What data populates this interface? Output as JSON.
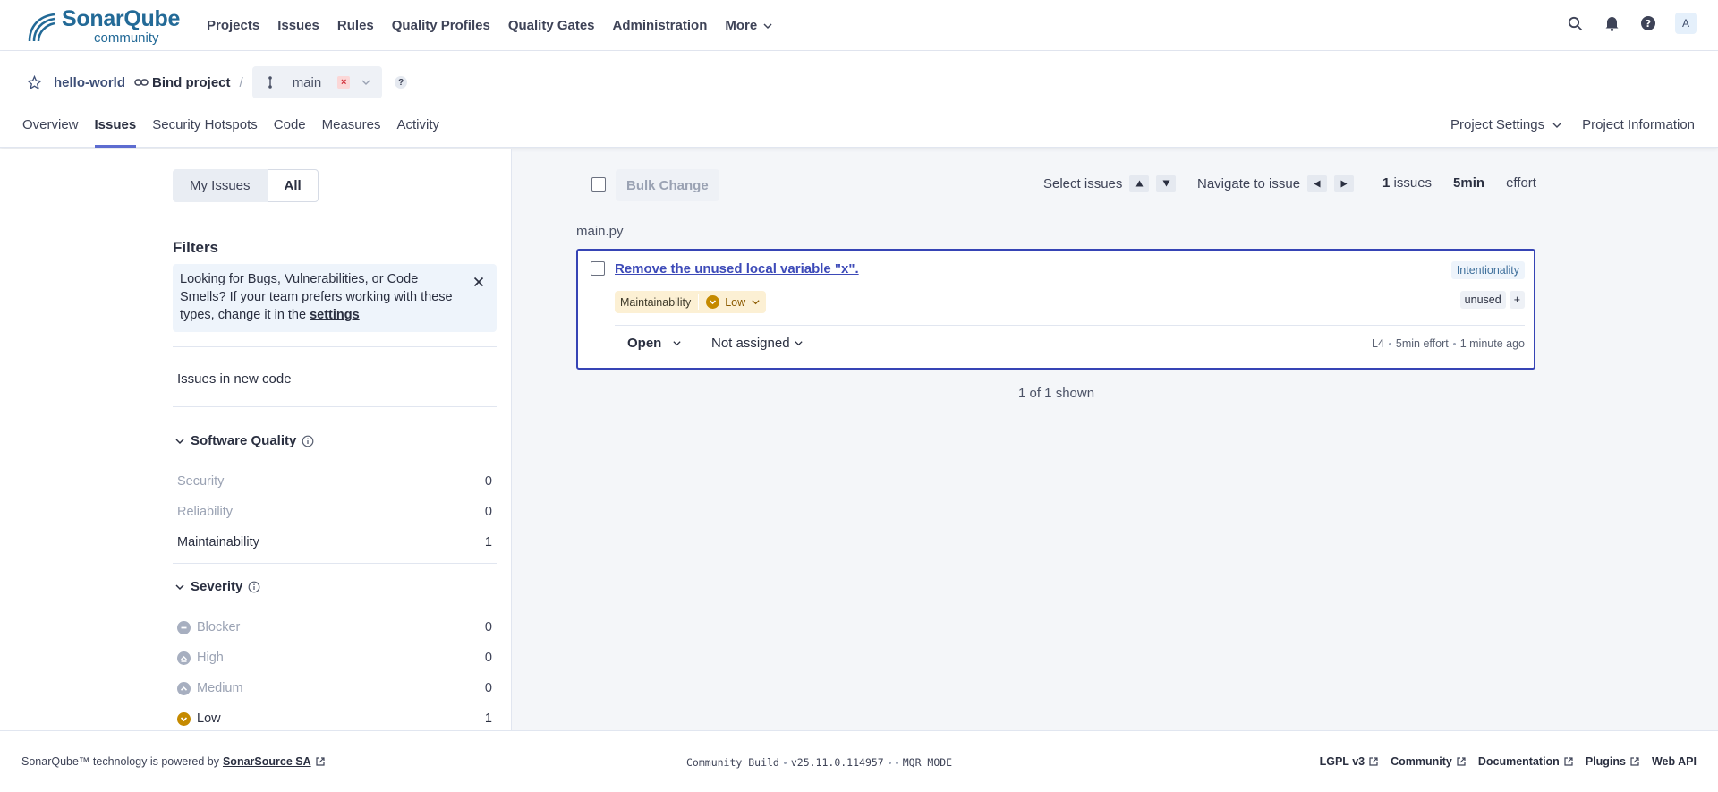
{
  "brand": {
    "title": "SonarQube",
    "subtitle": "community"
  },
  "nav": {
    "items": [
      "Projects",
      "Issues",
      "Rules",
      "Quality Profiles",
      "Quality Gates",
      "Administration"
    ],
    "more": "More",
    "avatar": "A"
  },
  "project": {
    "name": "hello-world",
    "bind": "Bind project",
    "separator": "/",
    "branch": "main",
    "branch_status": "×",
    "help": "?",
    "tabs": [
      "Overview",
      "Issues",
      "Security Hotspots",
      "Code",
      "Measures",
      "Activity"
    ],
    "active_tab": "Issues",
    "settings": "Project Settings",
    "information": "Project Information"
  },
  "sidebar": {
    "my_issues": "My Issues",
    "all": "All",
    "filters_title": "Filters",
    "banner_text": "Looking for Bugs, Vulnerabilities, or Code Smells? If your team prefers working with these types, change it in the ",
    "banner_link": "settings",
    "new_code": "Issues in new code",
    "software_quality": {
      "title": "Software Quality",
      "rows": [
        {
          "label": "Security",
          "count": "0"
        },
        {
          "label": "Reliability",
          "count": "0"
        },
        {
          "label": "Maintainability",
          "count": "1"
        }
      ]
    },
    "severity": {
      "title": "Severity",
      "rows": [
        {
          "label": "Blocker",
          "count": "0"
        },
        {
          "label": "High",
          "count": "0"
        },
        {
          "label": "Medium",
          "count": "0"
        },
        {
          "label": "Low",
          "count": "1"
        }
      ]
    }
  },
  "toolbar": {
    "bulk_change": "Bulk Change",
    "select_issues": "Select issues",
    "navigate_to_issue": "Navigate to issue",
    "issues_count": "1",
    "issues_label": "issues",
    "effort_value": "5min",
    "effort_label": "effort"
  },
  "list": {
    "file": "main.py",
    "issue": {
      "title": "Remove the unused local variable \"x\".",
      "attribute": "Intentionality",
      "quality": "Maintainability",
      "severity": "Low",
      "tag": "unused",
      "add_tag": "+",
      "status": "Open",
      "assignee": "Not assigned",
      "line": "L4",
      "effort": "5min effort",
      "age": "1 minute ago"
    },
    "shown": "1 of 1 shown"
  },
  "footer": {
    "powered_text": "SonarQube™ technology is powered by",
    "powered_link": "SonarSource SA",
    "edition": "Community Build",
    "version": "v25.11.0.114957",
    "mode": "MQR MODE",
    "links": [
      "LGPL v3",
      "Community",
      "Documentation",
      "Plugins",
      "Web API"
    ]
  },
  "colors": {
    "accent": "#3644b5",
    "low_severity": "#c58a00",
    "brand": "#236a97"
  }
}
